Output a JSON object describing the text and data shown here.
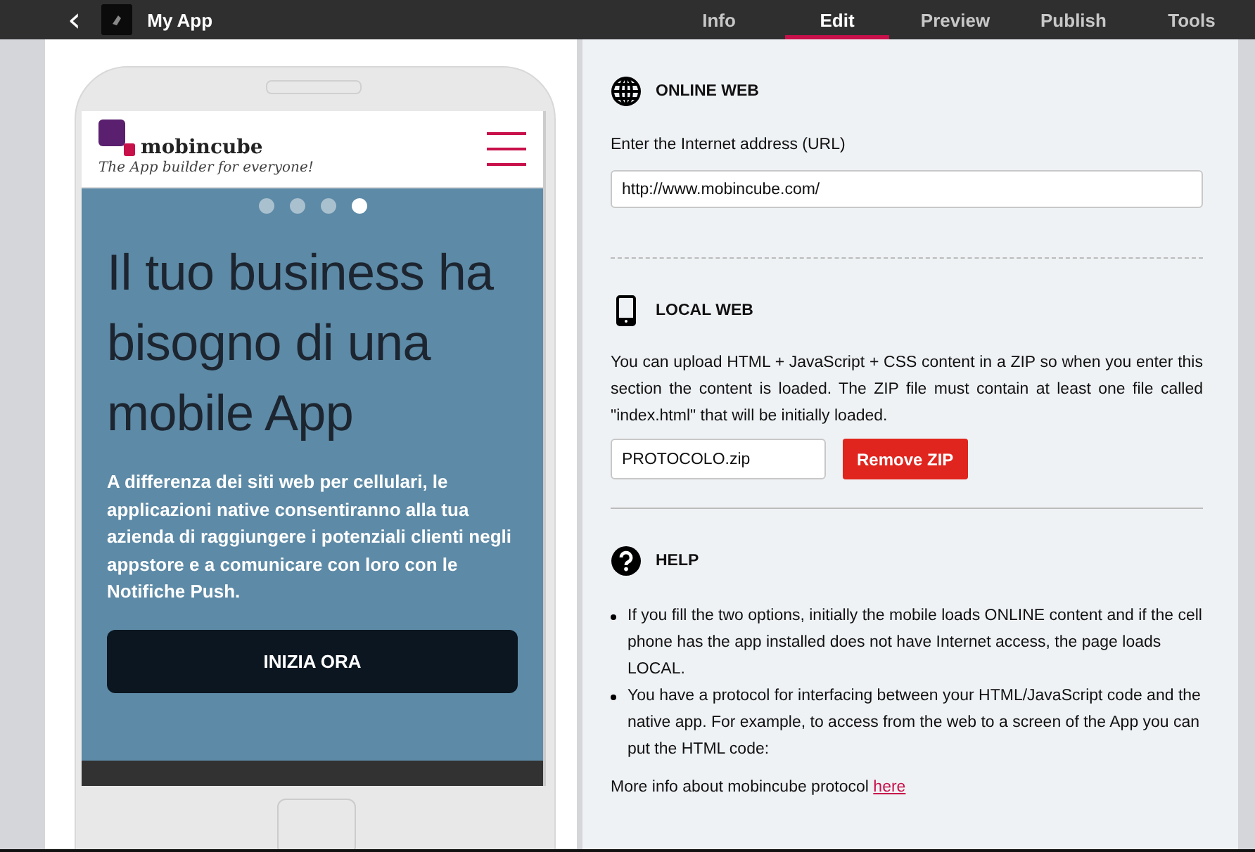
{
  "topbar": {
    "back": "‹",
    "title": "My App",
    "tabs": [
      {
        "label": "Info",
        "selected": false
      },
      {
        "label": "Edit",
        "selected": true
      },
      {
        "label": "Preview",
        "selected": false
      },
      {
        "label": "Publish",
        "selected": false
      },
      {
        "label": "Tools",
        "selected": false
      }
    ]
  },
  "phone": {
    "brand": "mobincube",
    "tagline": "The App builder for everyone!",
    "dots": [
      {
        "selected": false
      },
      {
        "selected": false
      },
      {
        "selected": false
      },
      {
        "selected": true
      }
    ],
    "headline": "Il tuo business ha bisogno di una mobile App",
    "body": "A differenza dei siti web per cellulari, le applicazioni native consentiranno alla tua azienda di raggiungere i potenziali clienti negli appstore e a comunicare con loro con le Notifiche Push.",
    "button": "INIZIA ORA"
  },
  "sections": [
    {
      "kind": "online",
      "title": "ONLINE WEB",
      "label": "Enter the Internet address (URL)",
      "value": "http://www.mobincube.com/"
    },
    {
      "kind": "local",
      "title": "LOCAL WEB",
      "text": "You can upload HTML + JavaScript + CSS content in a ZIP so when you enter this section the content is loaded. The ZIP file must contain at least one file called \"index.html\" that will be initially loaded.",
      "value": "PROTOCOLO.zip",
      "button": "Remove ZIP"
    },
    {
      "kind": "help",
      "title": "HELP",
      "bullets": [
        "If you fill the two options, initially the mobile loads ONLINE content and if the cell phone has the app installed does not have Internet access, the page loads LOCAL.",
        "You have a protocol for interfacing between your HTML/JavaScript code and the native app. For example, to access from the web to a screen of the App you can put the HTML code:"
      ],
      "more": "More info about mobincube protocol",
      "link": "here"
    }
  ]
}
